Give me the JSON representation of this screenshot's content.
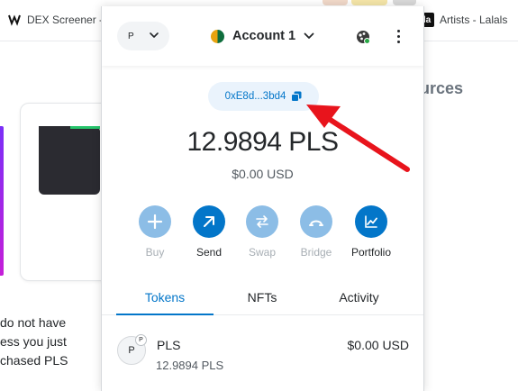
{
  "bookmarks": {
    "dex_label": "DEX Screener -",
    "artists_label": "Artists - Lalals",
    "dex_icon": "dex-screener-logo-icon",
    "artists_icon": "lalals-logo-icon"
  },
  "background_page": {
    "heading_fragment": "urces",
    "text_lines": [
      "do not have",
      "ess you just",
      "chased PLS"
    ]
  },
  "header": {
    "network_letter": "P",
    "network_chevron_icon": "chevron-down-icon",
    "account_name": "Account 1",
    "account_chevron_icon": "chevron-down-icon",
    "connected_sites_icon": "connected-sites-icon",
    "menu_icon": "vertical-dots-icon"
  },
  "address": {
    "short": "0xE8d...3bd4",
    "copy_icon": "copy-icon"
  },
  "balance": {
    "amount": "12.9894 PLS",
    "fiat": "$0.00 USD"
  },
  "actions": [
    {
      "label": "Buy",
      "icon": "plus-icon",
      "enabled": false
    },
    {
      "label": "Send",
      "icon": "arrow-up-right-icon",
      "enabled": true
    },
    {
      "label": "Swap",
      "icon": "swap-arrows-icon",
      "enabled": false
    },
    {
      "label": "Bridge",
      "icon": "bridge-icon",
      "enabled": false
    },
    {
      "label": "Portfolio",
      "icon": "chart-line-icon",
      "enabled": true
    }
  ],
  "tabs": [
    {
      "label": "Tokens",
      "active": true
    },
    {
      "label": "NFTs",
      "active": false
    },
    {
      "label": "Activity",
      "active": false
    }
  ],
  "tokens": [
    {
      "icon_letter": "P",
      "badge_letter": "P",
      "symbol": "PLS",
      "fiat": "$0.00 USD",
      "amount": "12.9894 PLS"
    }
  ],
  "colors": {
    "accent": "#0376c9",
    "accent_disabled": "#8cbde6",
    "annotation_arrow": "#e8141c",
    "text_primary": "#24272a",
    "text_muted": "#535a61"
  }
}
